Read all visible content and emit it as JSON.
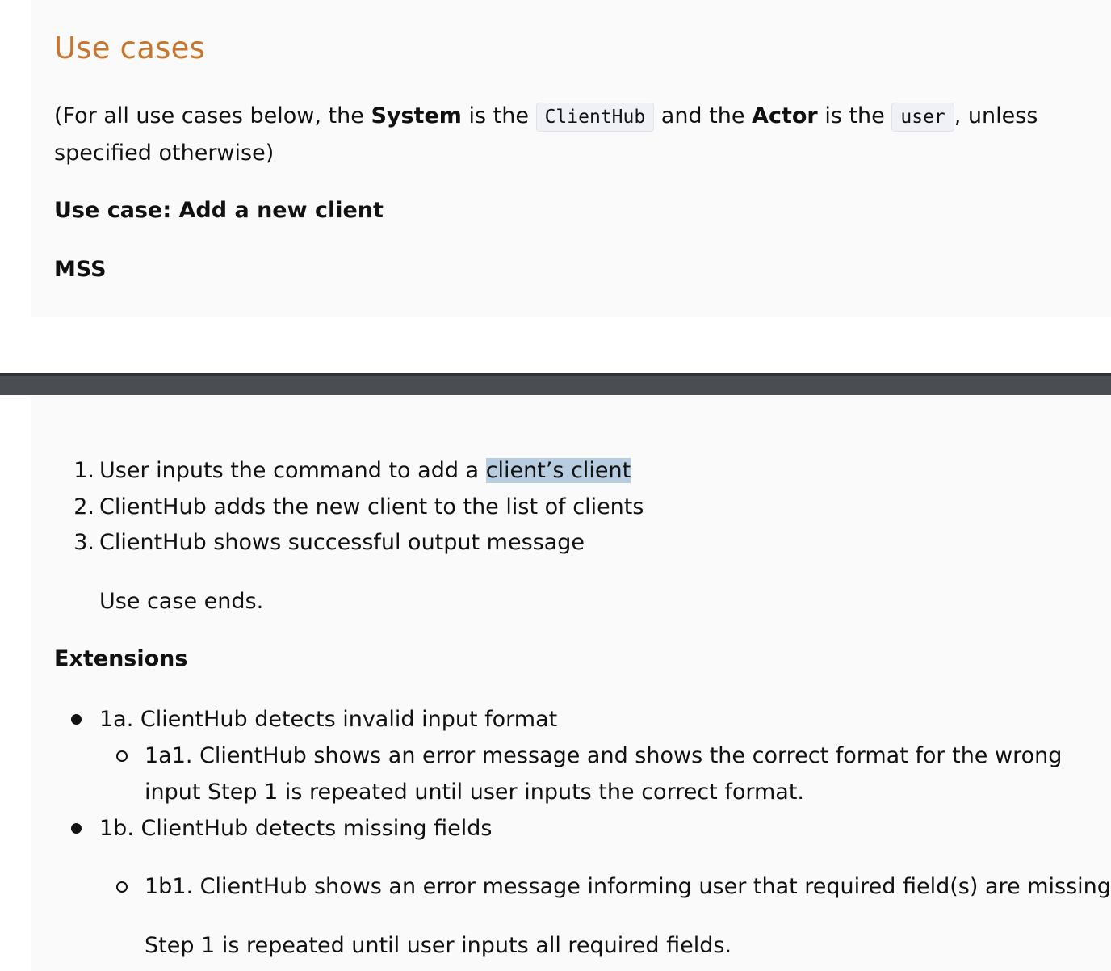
{
  "heading": "Use cases",
  "intro": {
    "part1": "(For all use cases below, the ",
    "system_label": "System",
    "part2": " is the ",
    "system_code": "ClientHub",
    "part3": " and the ",
    "actor_label": "Actor",
    "part4": " is the ",
    "actor_code": "user",
    "part5": ", unless",
    "line2": "specified otherwise)"
  },
  "use_case_title": "Use case: Add a new client",
  "mss_label": "MSS",
  "mss_steps": [
    {
      "num": "1.",
      "text": "User inputs the command to add a ",
      "highlight": "client’s client"
    },
    {
      "num": "2.",
      "text": "ClientHub adds the new client to the list of clients"
    },
    {
      "num": "3.",
      "text": "ClientHub shows successful output message"
    }
  ],
  "use_case_ends": "Use case ends.",
  "extensions_label": "Extensions",
  "extensions": {
    "e1a": "1a. ClientHub detects invalid input format",
    "e1a1_line1": "1a1. ClientHub shows an error message and shows the correct format for the wrong",
    "e1a1_line2": "input Step 1 is repeated until user inputs the correct format.",
    "e1b": "1b. ClientHub detects missing fields",
    "e1b1": "1b1. ClientHub shows an error message informing user that required field(s) are missing",
    "e1b1_note": "Step 1 is repeated until user inputs all required fields."
  }
}
